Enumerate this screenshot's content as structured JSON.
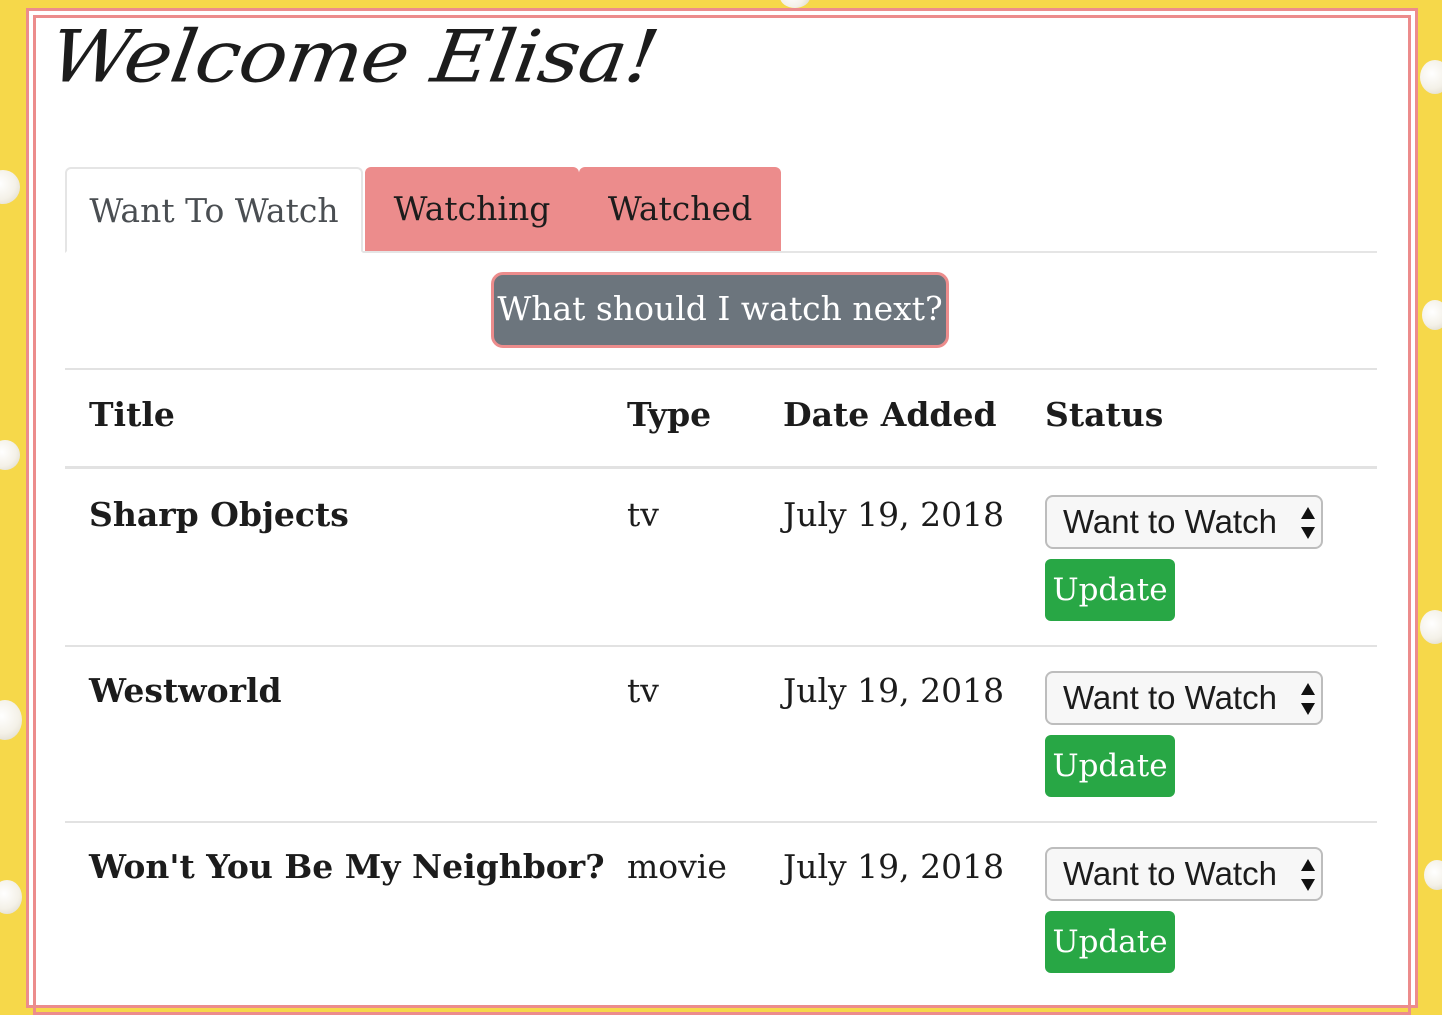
{
  "header": {
    "title": "Welcome Elisa!"
  },
  "tabs": [
    {
      "label": "Want To Watch",
      "active": true
    },
    {
      "label": "Watching",
      "active": false
    },
    {
      "label": "Watched",
      "active": false
    }
  ],
  "suggest_button": "What should I watch next?",
  "table": {
    "headers": [
      "Title",
      "Type",
      "Date Added",
      "Status"
    ],
    "rows": [
      {
        "title": "Sharp Objects",
        "type": "tv",
        "date": "July 19, 2018",
        "status": "Want to Watch",
        "action": "Update"
      },
      {
        "title": "Westworld",
        "type": "tv",
        "date": "July 19, 2018",
        "status": "Want to Watch",
        "action": "Update"
      },
      {
        "title": "Won't You Be My Neighbor?",
        "type": "movie",
        "date": "July 19, 2018",
        "status": "Want to Watch",
        "action": "Update"
      }
    ]
  },
  "colors": {
    "accent": "#ec8c8c",
    "button_gray": "#6c757d",
    "update_green": "#28a745",
    "background": "#f6d84a"
  }
}
